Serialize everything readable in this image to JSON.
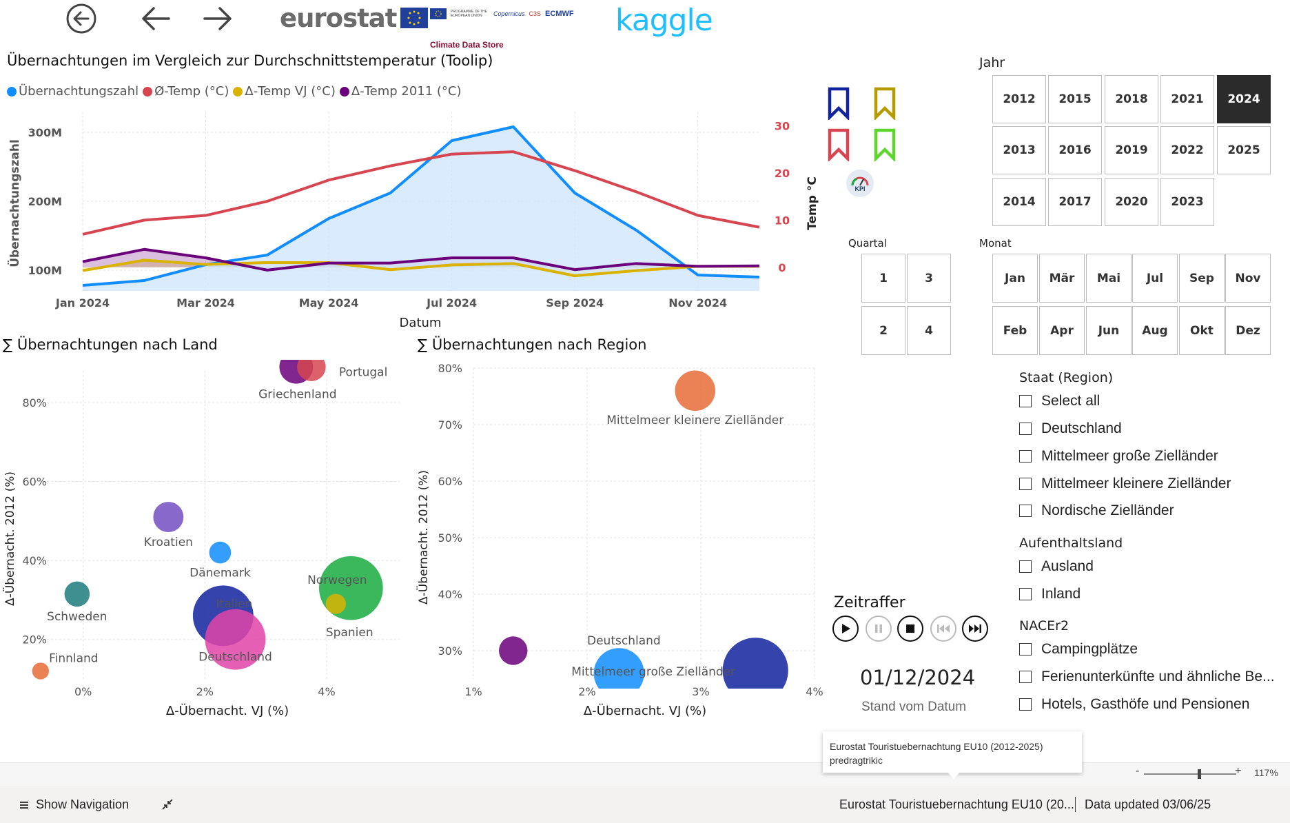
{
  "header": {
    "eurostat_logo": "eurostat",
    "partner_logos": [
      "PROGRAMME OF THE EUROPEAN UNION",
      "Copernicus",
      "C3S",
      "ECMWF"
    ],
    "climate_data_store": "Climate Data Store",
    "kaggle_logo": "kaggle"
  },
  "line_chart": {
    "title": "Übernachtungen im Vergleich zur Durchschnittstemperatur (Toolip)",
    "legend": [
      {
        "label": "Übernachtungszahl",
        "color": "#118dff"
      },
      {
        "label": "Ø-Temp (°C)",
        "color": "#d64550"
      },
      {
        "label": "Δ-Temp VJ (°C)",
        "color": "#d9b300"
      },
      {
        "label": "Δ-Temp 2011 (°C)",
        "color": "#6b007b"
      }
    ]
  },
  "chart_data": [
    {
      "type": "line",
      "title": "Übernachtungen im Vergleich zur Durchschnittstemperatur (Toolip)",
      "xlabel": "Datum",
      "ylabel": "Übernachtungszahl",
      "y2label": "Temp °C",
      "x_ticks": [
        "Jan 2024",
        "Mar 2024",
        "May 2024",
        "Jul 2024",
        "Sep 2024",
        "Nov 2024"
      ],
      "y_ticks": [
        "100M",
        "200M",
        "300M"
      ],
      "y2_ticks": [
        "0",
        "10",
        "20",
        "30"
      ],
      "x": [
        "2024-01",
        "2024-02",
        "2024-03",
        "2024-04",
        "2024-05",
        "2024-06",
        "2024-07",
        "2024-08",
        "2024-09",
        "2024-10",
        "2024-11",
        "2024-12"
      ],
      "ylim": [
        70,
        330
      ],
      "y2lim": [
        -5,
        33
      ],
      "series": [
        {
          "name": "Übernachtungszahl",
          "axis": "left",
          "color": "#118dff",
          "values": [
            78,
            85,
            108,
            122,
            175,
            212,
            288,
            308,
            212,
            158,
            93,
            90
          ]
        },
        {
          "name": "Ø-Temp (°C)",
          "axis": "right",
          "color": "#d64550",
          "values": [
            7,
            10,
            11,
            14,
            18.5,
            21.5,
            24,
            24.5,
            20.5,
            16,
            11,
            8.5
          ]
        },
        {
          "name": "Δ-Temp VJ (°C)",
          "axis": "right",
          "color": "#d9b300",
          "values": [
            -0.7,
            1.5,
            0.6,
            1.0,
            1.0,
            -0.5,
            0.5,
            0.8,
            -1.8,
            -0.7,
            0.2,
            0.2
          ]
        },
        {
          "name": "Δ-Temp 2011 (°C)",
          "axis": "right",
          "color": "#6b007b",
          "values": [
            1.2,
            3.8,
            2.0,
            -0.6,
            0.9,
            0.9,
            2.0,
            2.0,
            -0.5,
            0.8,
            0.2,
            0.3
          ]
        }
      ]
    },
    {
      "type": "scatter",
      "title": "∑ Übernachtungen nach Land",
      "xlabel": "Δ-Übernacht. VJ (%)",
      "ylabel": "Δ-Übernacht. 2012 (%)",
      "x_ticks": [
        "0%",
        "2%",
        "4%"
      ],
      "y_ticks": [
        "20%",
        "40%",
        "60%",
        "80%"
      ],
      "xlim": [
        -0.8,
        5.2
      ],
      "ylim": [
        10,
        88
      ],
      "points": [
        {
          "label": "Griechenland",
          "x": 3.5,
          "y": 89,
          "size": 20,
          "color": "#6b007b"
        },
        {
          "label": "Portugal",
          "x": 3.75,
          "y": 89,
          "size": 17,
          "color": "#d64550"
        },
        {
          "label": "Kroatien",
          "x": 1.4,
          "y": 51,
          "size": 18,
          "color": "#744ec2"
        },
        {
          "label": "Dänemark",
          "x": 2.25,
          "y": 42,
          "size": 13,
          "color": "#118dff"
        },
        {
          "label": "Schweden",
          "x": -0.1,
          "y": 31.5,
          "size": 15,
          "color": "#1c7c7c"
        },
        {
          "label": "Italien",
          "x": 2.3,
          "y": 26,
          "size": 36,
          "color": "#12239e"
        },
        {
          "label": "Deutschland",
          "x": 2.5,
          "y": 20,
          "size": 36,
          "color": "#e044a7"
        },
        {
          "label": "Norwegen",
          "x": 4.4,
          "y": 33,
          "size": 38,
          "color": "#1aab40"
        },
        {
          "label": "Spanien",
          "x": 4.15,
          "y": 29,
          "size": 12,
          "color": "#d9b300"
        },
        {
          "label": "Finnland",
          "x": -0.7,
          "y": 12,
          "size": 10,
          "color": "#e66c37"
        }
      ]
    },
    {
      "type": "scatter",
      "title": "∑ Übernachtungen nach Region",
      "xlabel": "Δ-Übernacht. VJ (%)",
      "ylabel": "Δ-Übernacht. 2012 (%)",
      "x_ticks": [
        "1%",
        "2%",
        "3%",
        "4%"
      ],
      "y_ticks": [
        "30%",
        "40%",
        "50%",
        "60%",
        "70%",
        "80%"
      ],
      "xlim": [
        1,
        4
      ],
      "ylim": [
        25,
        80
      ],
      "points": [
        {
          "label": "Mittelmeer kleinere Zielländer",
          "x": 2.95,
          "y": 76,
          "size": 24,
          "color": "#e66c37"
        },
        {
          "label": "",
          "x": 1.35,
          "y": 30,
          "size": 17,
          "color": "#6b007b"
        },
        {
          "label": "Mittelmeer große Zielländer",
          "x": 2.28,
          "y": 26,
          "size": 30,
          "color": "#118dff"
        },
        {
          "label": "Deutschland",
          "x": 3.48,
          "y": 26.5,
          "size": 39,
          "color": "#12239e"
        }
      ]
    }
  ],
  "scatter_land": {
    "title": "∑ Übernachtungen nach Land"
  },
  "scatter_region": {
    "title": "∑ Übernachtungen nach Region"
  },
  "labels": {
    "region_deutschland": "Deutschland"
  },
  "slicers": {
    "jahr": {
      "title": "Jahr",
      "tiles": [
        "2012",
        "2015",
        "2018",
        "2021",
        "2024",
        "2013",
        "2016",
        "2019",
        "2022",
        "2025",
        "2014",
        "2017",
        "2020",
        "2023"
      ],
      "selected": "2024"
    },
    "quartal": {
      "title": "Quartal",
      "tiles": [
        "1",
        "3",
        "2",
        "4"
      ]
    },
    "monat": {
      "title": "Monat",
      "tiles": [
        "Jan",
        "Mär",
        "Mai",
        "Jul",
        "Sep",
        "Nov",
        "Feb",
        "Apr",
        "Jun",
        "Aug",
        "Okt",
        "Dez"
      ]
    },
    "staat": {
      "title": "Staat (Region)",
      "items": [
        "Select all",
        "Deutschland",
        "Mittelmeer große Zielländer",
        "Mittelmeer kleinere Zielländer",
        "Nordische Zielländer"
      ]
    },
    "aufenthaltsland": {
      "title": "Aufenthaltsland",
      "items": [
        "Ausland",
        "Inland"
      ]
    },
    "nacer": {
      "title": "NACEr2",
      "items": [
        "Campingplätze",
        "Ferienunterkünfte und ähnliche Be...",
        "Hotels, Gasthöfe und Pensionen"
      ]
    }
  },
  "bookmarks": {
    "colors": [
      "#12239e",
      "#b59a00",
      "#d64550",
      "#5dd62c"
    ],
    "kpi_label": "KPI"
  },
  "zeitraffer": {
    "title": "Zeitraffer",
    "date": "01/12/2024",
    "caption": "Stand vom Datum"
  },
  "tooltip": {
    "line1": "Eurostat Touristuebernachtung EU10 (2012-2025)",
    "line2": "predragtrikic"
  },
  "zoom": {
    "minus": "-",
    "plus": "+",
    "level": "117%",
    "fraction": 0.6
  },
  "footer": {
    "show_navigation": "Show Navigation",
    "report_name": "Eurostat Touristuebernachtung EU10 (20...",
    "data_updated": "Data updated 03/06/25"
  }
}
